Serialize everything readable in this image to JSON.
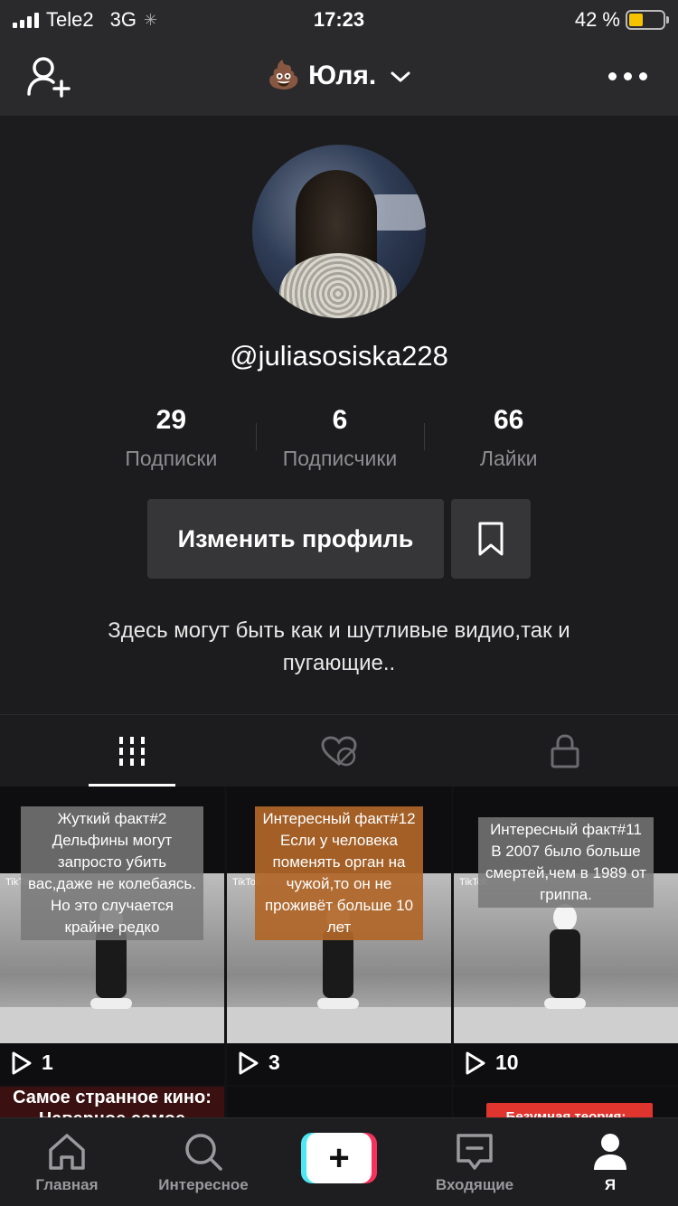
{
  "status_bar": {
    "carrier": "Tele2",
    "network": "3G",
    "time": "17:23",
    "battery_percent": "42 %",
    "battery_level": 0.42
  },
  "header": {
    "title_emoji": "💩",
    "title": "Юля.",
    "icons": [
      "add-user-icon",
      "chevron-down-icon",
      "more-icon"
    ]
  },
  "profile": {
    "username": "@juliasosiska228",
    "stats": [
      {
        "value": "29",
        "label": "Подписки"
      },
      {
        "value": "6",
        "label": "Подписчики"
      },
      {
        "value": "66",
        "label": "Лайки"
      }
    ],
    "edit_button": "Изменить профиль",
    "bio": "Здесь могут быть как и шутливые видио,так и пугающие.."
  },
  "tabs": [
    {
      "icon": "grid-icon",
      "active": true
    },
    {
      "icon": "liked-hidden-icon",
      "active": false
    },
    {
      "icon": "lock-icon",
      "active": false
    }
  ],
  "videos": [
    {
      "caption": "Жуткий факт#2\nДельфины могут\nзапросто убить\nвас,даже не колебаясь.\nНо это случается\nкрайне редко",
      "plays": "1",
      "style": "gray"
    },
    {
      "caption": "Интересный факт#12\nЕсли у человека\nпоменять орган на\nчужой,то он не\nпроживёт больше 10\nлет",
      "plays": "3",
      "style": "orange"
    },
    {
      "caption": "Интересный факт#11\nВ 2007 было больше\nсмертей,чем в 1989 от\nгриппа.",
      "plays": "10",
      "style": "gray"
    }
  ],
  "videos_row2": [
    {
      "caption_peek": "Самое странное кино:\nНаверное самое"
    },
    {
      "caption_peek": ""
    },
    {
      "caption_peek": "Безумная теория:"
    }
  ],
  "tiktok_watermark": "TikTok",
  "bottom_nav": [
    {
      "label": "Главная",
      "icon": "home-icon"
    },
    {
      "label": "Интересное",
      "icon": "search-icon"
    },
    {
      "label": "",
      "icon": "plus-icon"
    },
    {
      "label": "Входящие",
      "icon": "inbox-icon"
    },
    {
      "label": "Я",
      "icon": "profile-icon"
    }
  ],
  "colors": {
    "accent_cyan": "#4de8f4",
    "accent_red": "#f6325c",
    "caption_orange": "#b06628",
    "battery_yellow": "#f4c400"
  }
}
